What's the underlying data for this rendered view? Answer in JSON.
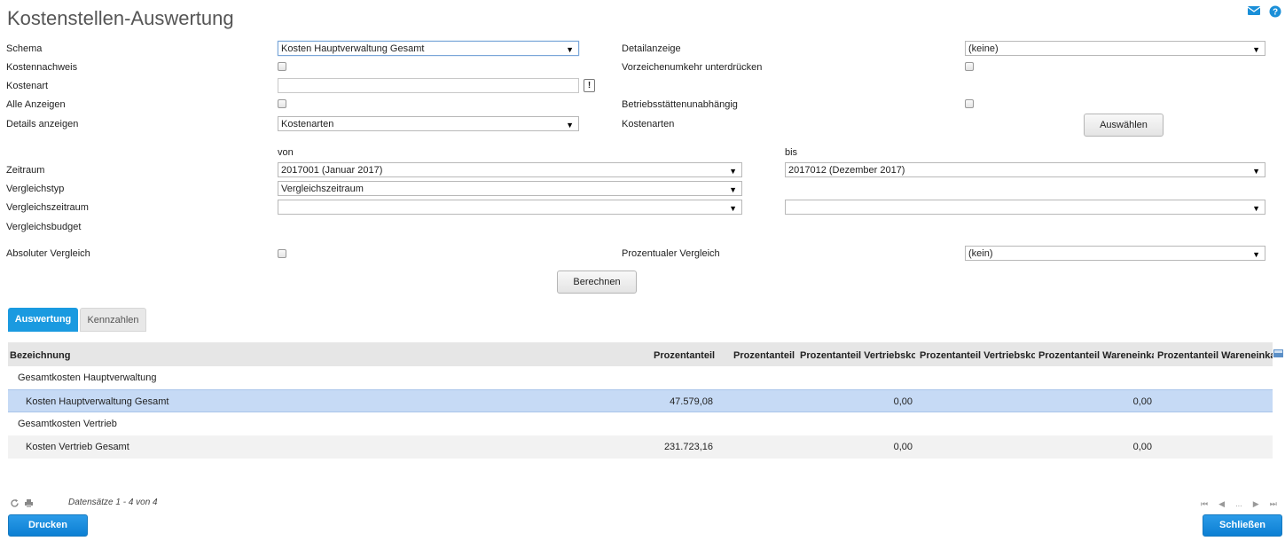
{
  "title": "Kostenstellen-Auswertung",
  "colors": {
    "accent": "#1a9ae0",
    "selection": "#c6daf5",
    "header_bg": "#e6e6e6"
  },
  "header_icons": {
    "mail": "mail-icon",
    "help": "help-icon"
  },
  "form": {
    "schema_label": "Schema",
    "schema_value": "Kosten Hauptverwaltung Gesamt",
    "kostennachweis_label": "Kostennachweis",
    "kostenart_label": "Kostenart",
    "kostenart_value": "",
    "kostenart_btn": "!",
    "alle_anzeigen_label": "Alle Anzeigen",
    "details_label": "Details anzeigen",
    "details_value": "Kostenarten",
    "detailanzeige_label": "Detailanzeige",
    "detailanzeige_value": "(keine)",
    "vorzeichen_label": "Vorzeichenumkehr unterdrücken",
    "betriebsstaetten_label": "Betriebsstättenunabhängig",
    "kostenarten_label": "Kostenarten",
    "auswaehlen_btn": "Auswählen",
    "von_label": "von",
    "bis_label": "bis",
    "zeitraum_label": "Zeitraum",
    "zeitraum_von": "2017001 (Januar 2017)",
    "zeitraum_bis": "2017012 (Dezember 2017)",
    "vergleichstyp_label": "Vergleichstyp",
    "vergleichstyp_value": "Vergleichszeitraum",
    "vergleichszeitraum_label": "Vergleichszeitraum",
    "vergleichszeitraum_von": "",
    "vergleichszeitraum_bis": "",
    "vergleichsbudget_label": "Vergleichsbudget",
    "absoluter_label": "Absoluter Vergleich",
    "prozentualer_label": "Prozentualer Vergleich",
    "prozentualer_value": "(kein)",
    "berechnen_btn": "Berechnen"
  },
  "tabs": [
    {
      "label": "Auswertung",
      "active": true
    },
    {
      "label": "Kennzahlen",
      "active": false
    }
  ],
  "grid": {
    "columns": [
      "Bezeichnung",
      "Prozentanteil",
      "Prozentanteil",
      "Prozentanteil Vertriebsko",
      "Prozentanteil Vertriebsko",
      "Prozentanteil Wareneinka",
      "Prozentanteil Wareneinka"
    ],
    "rows": [
      {
        "type": "group",
        "label": "Gesamtkosten Hauptverwaltung",
        "v1": "",
        "v2": "",
        "v3": ""
      },
      {
        "type": "item",
        "label": "Kosten Hauptverwaltung Gesamt",
        "v1": "47.579,08",
        "v2": "0,00",
        "v3": "0,00"
      },
      {
        "type": "group",
        "label": "Gesamtkosten Vertrieb",
        "v1": "",
        "v2": "",
        "v3": ""
      },
      {
        "type": "item",
        "label": "Kosten Vertrieb Gesamt",
        "v1": "231.723,16",
        "v2": "0,00",
        "v3": "0,00"
      }
    ]
  },
  "footer": {
    "records": "Datensätze 1 - 4 von 4",
    "pager_ellipsis": "...",
    "drucken_btn": "Drucken",
    "schliessen_btn": "Schließen"
  }
}
